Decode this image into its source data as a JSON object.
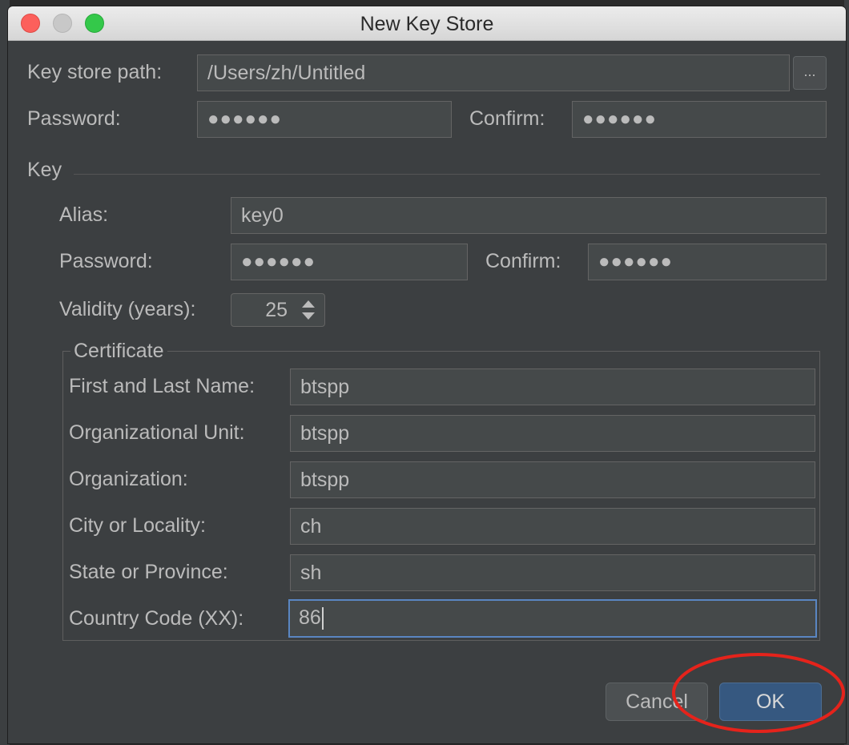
{
  "dialog": {
    "title": "New Key Store",
    "keystore_path_label": "Key store path:",
    "keystore_path_value": "/Users/zh/Untitled",
    "browse_label": "...",
    "password_label": "Password:",
    "password_mask": "●●●●●●",
    "confirm_label": "Confirm:",
    "confirm_mask": "●●●●●●"
  },
  "key": {
    "section_label": "Key",
    "alias_label": "Alias:",
    "alias_value": "key0",
    "password_label": "Password:",
    "password_mask": "●●●●●●",
    "confirm_label": "Confirm:",
    "confirm_mask": "●●●●●●",
    "validity_label": "Validity (years):",
    "validity_value": "25"
  },
  "certificate": {
    "legend": "Certificate",
    "fields": [
      {
        "label": "First and Last Name:",
        "value": "btspp"
      },
      {
        "label": "Organizational Unit:",
        "value": "btspp"
      },
      {
        "label": "Organization:",
        "value": "btspp"
      },
      {
        "label": "City or Locality:",
        "value": "ch"
      },
      {
        "label": "State or Province:",
        "value": "sh"
      },
      {
        "label": "Country Code (XX):",
        "value": "86"
      }
    ]
  },
  "buttons": {
    "cancel": "Cancel",
    "ok": "OK"
  },
  "annotation": {
    "highlight_color": "#e5231b"
  }
}
